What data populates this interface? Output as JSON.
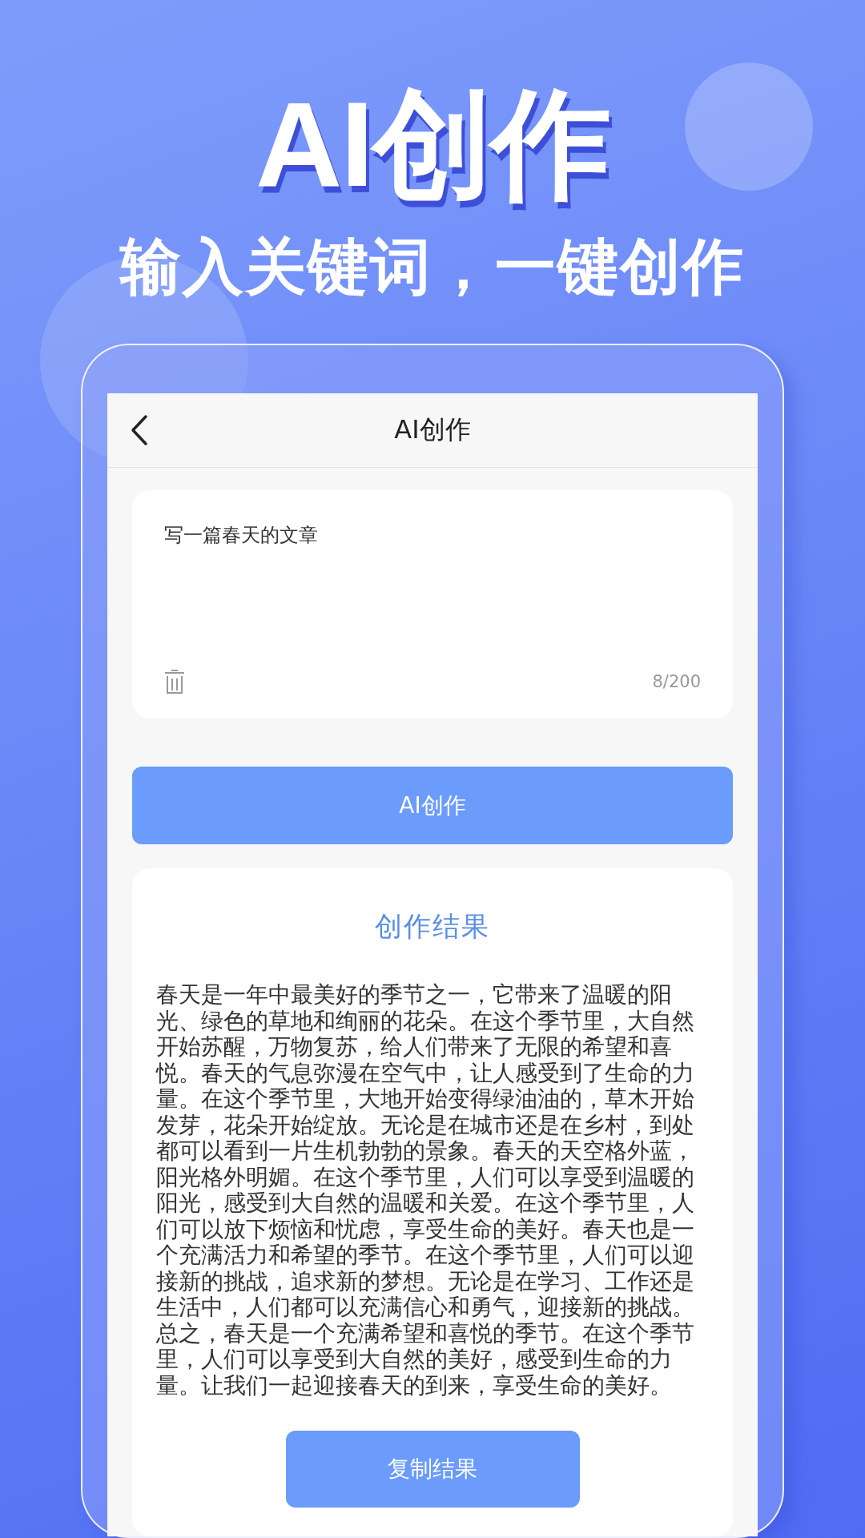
{
  "headline": "AI创作",
  "subheadline": "输入关键词，一键创作",
  "screen": {
    "title": "AI创作",
    "prompt": {
      "value": "写一篇春天的文章",
      "counter": "8/200"
    },
    "create_button": "AI创作",
    "result": {
      "title": "创作结果",
      "text": "春天是一年中最美好的季节之一，它带来了温暖的阳光、绿色的草地和绚丽的花朵。在这个季节里，大自然开始苏醒，万物复苏，给人们带来了无限的希望和喜悦。春天的气息弥漫在空气中，让人感受到了生命的力量。在这个季节里，大地开始变得绿油油的，草木开始发芽，花朵开始绽放。无论是在城市还是在乡村，到处都可以看到一片生机勃勃的景象。春天的天空格外蓝，阳光格外明媚。在这个季节里，人们可以享受到温暖的阳光，感受到大自然的温暖和关爱。在这个季节里，人们可以放下烦恼和忧虑，享受生命的美好。春天也是一个充满活力和希望的季节。在这个季节里，人们可以迎接新的挑战，追求新的梦想。无论是在学习、工作还是生活中，人们都可以充满信心和勇气，迎接新的挑战。总之，春天是一个充满希望和喜悦的季节。在这个季节里，人们可以享受到大自然的美好，感受到生命的力量。让我们一起迎接春天的到来，享受生命的美好。",
      "copy_button": "复制结果"
    }
  }
}
